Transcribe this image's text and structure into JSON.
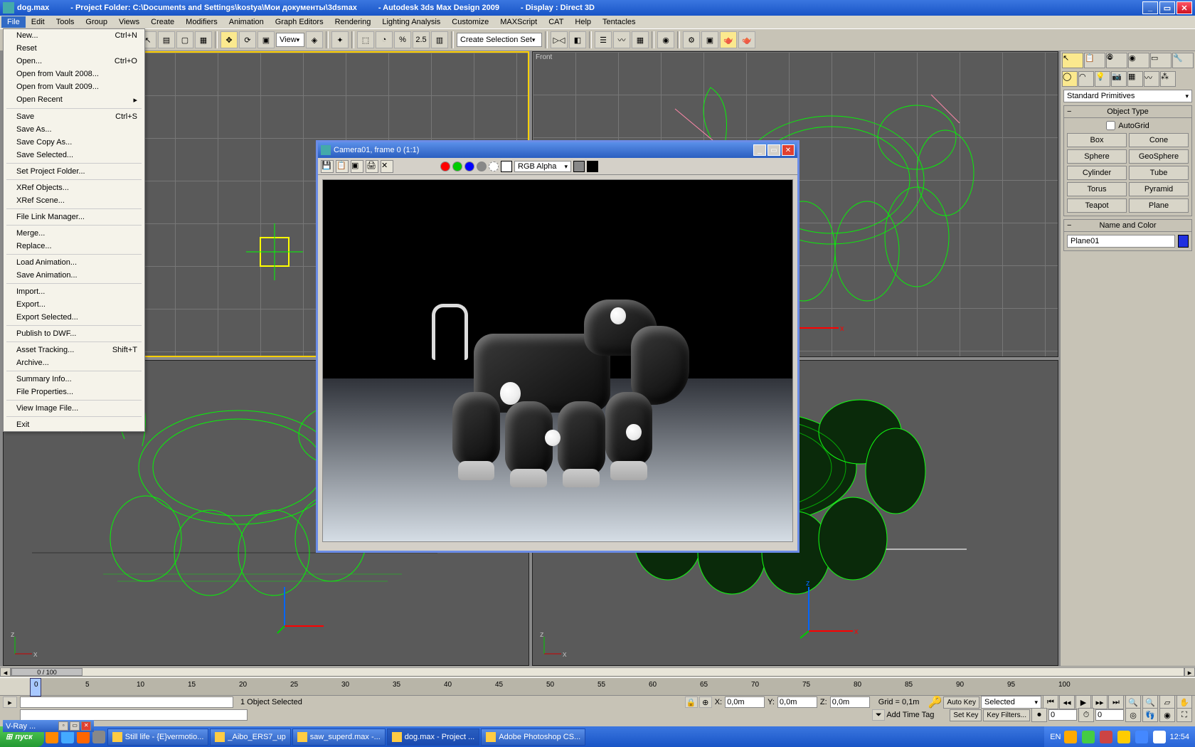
{
  "title": {
    "file": "dog.max",
    "project": "- Project Folder: C:\\Documents and Settings\\kostya\\Мои документы\\3dsmax",
    "app": "- Autodesk 3ds Max Design 2009",
    "display": "- Display : Direct 3D"
  },
  "menubar": [
    "File",
    "Edit",
    "Tools",
    "Group",
    "Views",
    "Create",
    "Modifiers",
    "Animation",
    "Graph Editors",
    "Rendering",
    "Lighting Analysis",
    "Customize",
    "MAXScript",
    "CAT",
    "Help",
    "Tentacles"
  ],
  "file_menu": [
    {
      "label": "New...",
      "accel": "Ctrl+N"
    },
    {
      "label": "Reset"
    },
    {
      "label": "Open...",
      "accel": "Ctrl+O"
    },
    {
      "label": "Open from Vault 2008..."
    },
    {
      "label": "Open from Vault 2009..."
    },
    {
      "label": "Open Recent",
      "sub": true
    },
    {
      "sep": true
    },
    {
      "label": "Save",
      "accel": "Ctrl+S"
    },
    {
      "label": "Save As..."
    },
    {
      "label": "Save Copy As..."
    },
    {
      "label": "Save Selected..."
    },
    {
      "sep": true
    },
    {
      "label": "Set Project Folder..."
    },
    {
      "sep": true
    },
    {
      "label": "XRef Objects..."
    },
    {
      "label": "XRef Scene..."
    },
    {
      "sep": true
    },
    {
      "label": "File Link Manager..."
    },
    {
      "sep": true
    },
    {
      "label": "Merge..."
    },
    {
      "label": "Replace..."
    },
    {
      "sep": true
    },
    {
      "label": "Load Animation..."
    },
    {
      "label": "Save Animation..."
    },
    {
      "sep": true
    },
    {
      "label": "Import..."
    },
    {
      "label": "Export..."
    },
    {
      "label": "Export Selected..."
    },
    {
      "sep": true
    },
    {
      "label": "Publish to DWF..."
    },
    {
      "sep": true
    },
    {
      "label": "Asset Tracking...",
      "accel": "Shift+T"
    },
    {
      "label": "Archive..."
    },
    {
      "sep": true
    },
    {
      "label": "Summary Info..."
    },
    {
      "label": "File Properties..."
    },
    {
      "sep": true
    },
    {
      "label": "View Image File..."
    },
    {
      "sep": true
    },
    {
      "label": "Exit"
    }
  ],
  "toolbar": {
    "view_label": "View",
    "snap_label": "2.5",
    "create_set": "Create Selection Set"
  },
  "viewports": {
    "tl": "",
    "tr": "Front",
    "bl": "",
    "br": ""
  },
  "right_panel": {
    "dropdown": "Standard Primitives",
    "rollout1": "Object Type",
    "autogrid": "AutoGrid",
    "primitives": [
      "Box",
      "Cone",
      "Sphere",
      "GeoSphere",
      "Cylinder",
      "Tube",
      "Torus",
      "Pyramid",
      "Teapot",
      "Plane"
    ],
    "rollout2": "Name and Color",
    "object_name": "Plane01"
  },
  "render": {
    "title": "Camera01, frame 0 (1:1)",
    "channel": "RGB Alpha"
  },
  "timeline": {
    "pos": "0 / 100",
    "ticks": [
      0,
      5,
      10,
      15,
      20,
      25,
      30,
      35,
      40,
      45,
      50,
      55,
      60,
      65,
      70,
      75,
      80,
      85,
      90,
      95,
      100
    ]
  },
  "status": {
    "selected": "1 Object Selected",
    "x": "0,0m",
    "y": "0,0m",
    "z": "0,0m",
    "grid": "Grid = 0,1m",
    "auto_key": "Auto Key",
    "set_key": "Set Key",
    "key_mode": "Selected",
    "key_filters": "Key Filters...",
    "add_tag": "Add Time Tag",
    "frame": "0",
    "spinner": "0"
  },
  "vray_title": "V-Ray ...",
  "taskbar": {
    "start": "пуск",
    "tasks": [
      "Still life - {E}vermotio...",
      "_Aibo_ERS7_up",
      "saw_superd.max  -...",
      "dog.max    - Project ...",
      "Adobe Photoshop CS..."
    ],
    "lang": "EN",
    "clock": "12:54"
  }
}
